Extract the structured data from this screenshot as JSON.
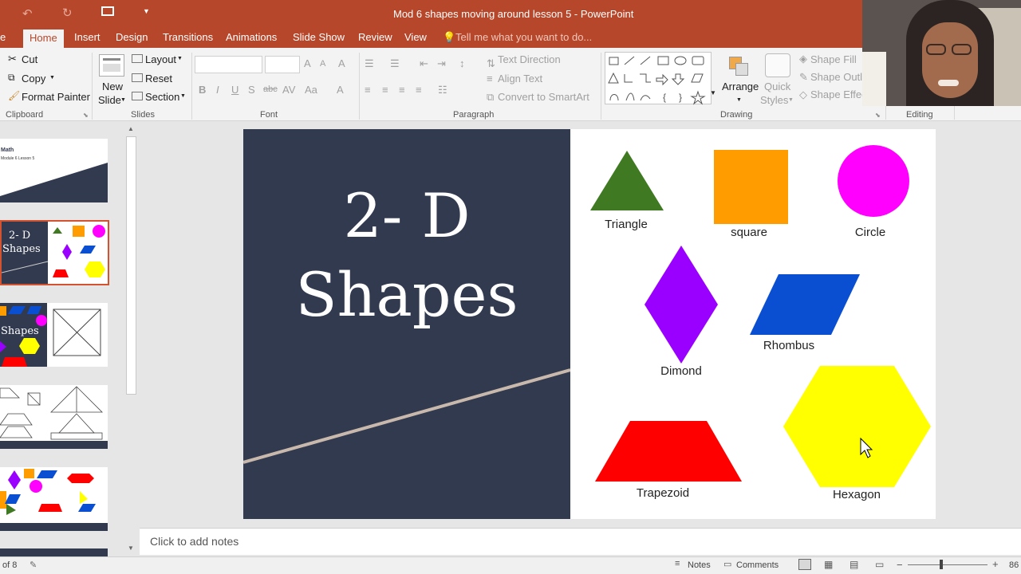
{
  "window": {
    "title": "Mod 6 shapes moving around lesson 5  -  PowerPoint"
  },
  "tabs": [
    "Home",
    "Insert",
    "Design",
    "Transitions",
    "Animations",
    "Slide Show",
    "Review",
    "View"
  ],
  "tell_me": "Tell me what you want to do...",
  "ribbon": {
    "clipboard": {
      "cut": "Cut",
      "copy": "Copy",
      "format_painter": "Format Painter",
      "group": "Clipboard"
    },
    "slides": {
      "new_slide_1": "New",
      "new_slide_2": "Slide",
      "layout": "Layout",
      "reset": "Reset",
      "section": "Section",
      "group": "Slides"
    },
    "font": {
      "group": "Font"
    },
    "paragraph": {
      "text_direction": "Text Direction",
      "align_text": "Align Text",
      "convert_smartart": "Convert to SmartArt",
      "group": "Paragraph"
    },
    "drawing": {
      "arrange": "Arrange",
      "quick_styles_1": "Quick",
      "quick_styles_2": "Styles",
      "shape_fill": "Shape Fill",
      "shape_outline": "Shape Outl",
      "shape_effects": "Shape Effec",
      "group": "Drawing"
    },
    "editing": {
      "group": "Editing"
    }
  },
  "thumbnails": {
    "t1": {
      "title": "Math",
      "subtitle": "Module 6 Lesson 5"
    },
    "t2": {
      "line1": "2- D",
      "line2": "Shapes"
    },
    "t3": {
      "title": "Shapes"
    }
  },
  "slide": {
    "title_line1": "2- D",
    "title_line2": "Shapes",
    "shapes": {
      "triangle": "Triangle",
      "square": "square",
      "circle": "Circle",
      "dimond": "Dimond",
      "rhombus": "Rhombus",
      "trapezoid": "Trapezoid",
      "hexagon": "Hexagon"
    },
    "colors": {
      "triangle": "#3f7a22",
      "square": "#ff9c00",
      "circle": "#ff00ff",
      "dimond": "#9900ff",
      "rhombus": "#0a4fd1",
      "trapezoid": "#ff0000",
      "hexagon": "#ffff00",
      "panel": "#323a4f",
      "accent": "#b7472a"
    }
  },
  "notes_placeholder": "Click to add notes",
  "status": {
    "slide_count": "of 8",
    "notes": "Notes",
    "comments": "Comments",
    "zoom": "86"
  }
}
